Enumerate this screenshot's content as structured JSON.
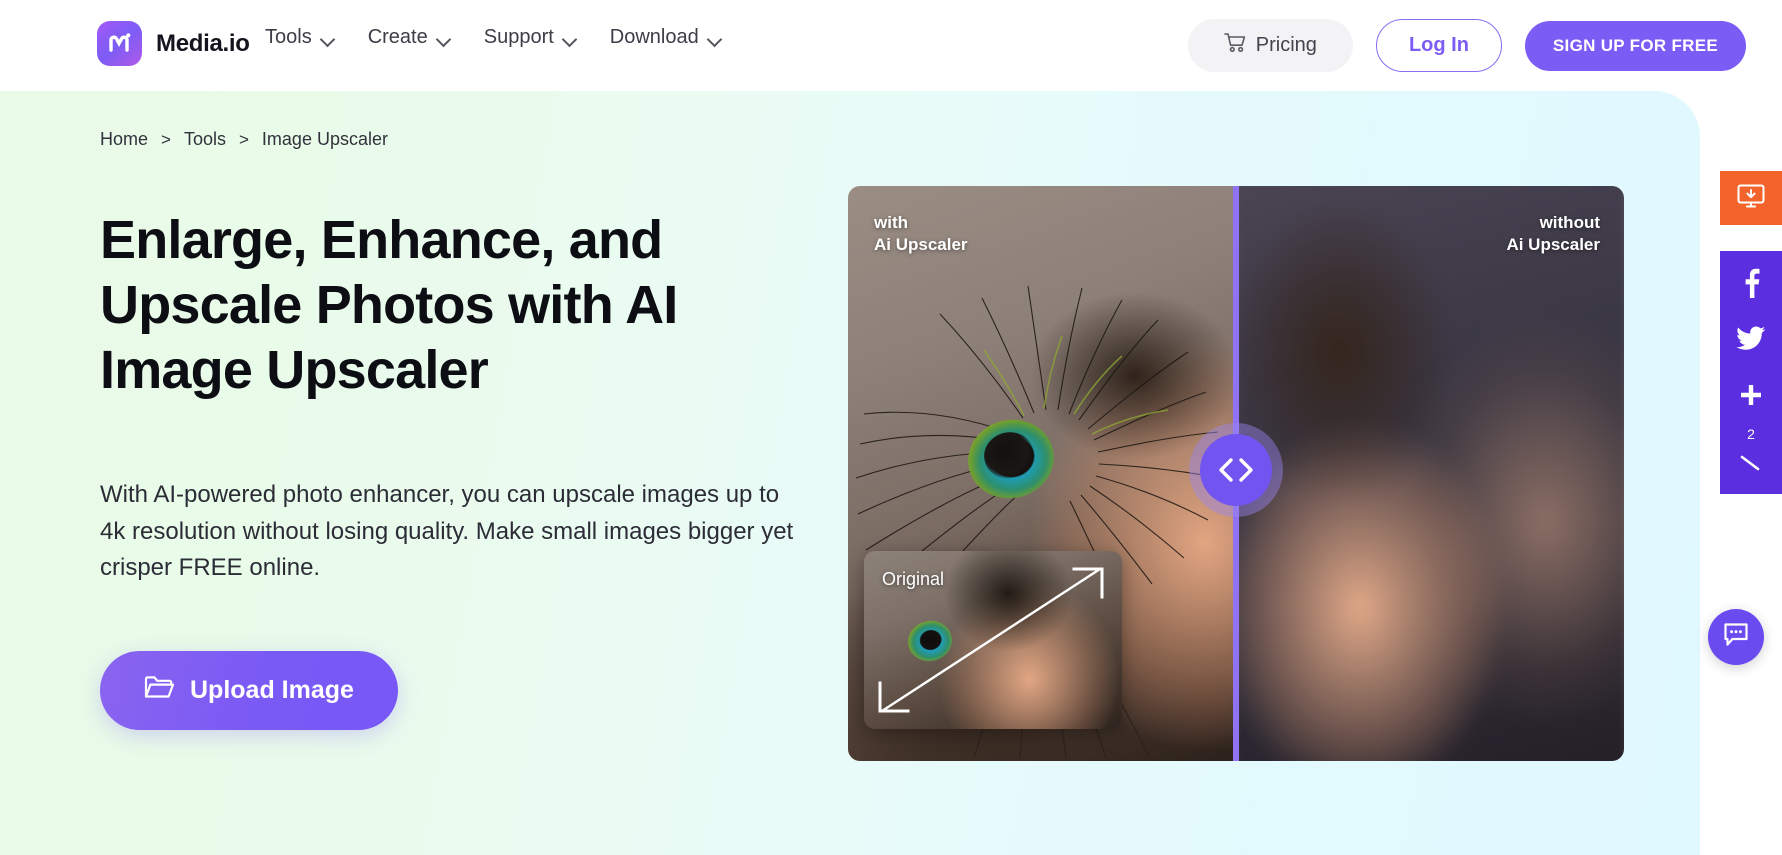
{
  "header": {
    "brand": "Media.io",
    "logo_icon": "media-io-logo-icon",
    "nav": [
      {
        "label": "Tools",
        "icon": "chevron-down-icon"
      },
      {
        "label": "Create",
        "icon": "chevron-down-icon"
      },
      {
        "label": "Support",
        "icon": "chevron-down-icon"
      },
      {
        "label": "Download",
        "icon": "chevron-down-icon"
      }
    ],
    "pricing_label": "Pricing",
    "pricing_icon": "shopping-cart-icon",
    "login_label": "Log In",
    "signup_label": "SIGN UP FOR FREE"
  },
  "breadcrumb": {
    "home": "Home",
    "sep1": ">",
    "tools": "Tools",
    "sep2": ">",
    "current": "Image Upscaler"
  },
  "hero": {
    "title": "Enlarge, Enhance, and Upscale Photos with AI Image Upscaler",
    "subtitle": "With AI-powered photo enhancer, you can upscale images up to 4k resolution without losing quality. Make small images bigger yet crisper FREE online.",
    "upload_label": "Upload Image",
    "upload_icon": "folder-icon"
  },
  "compare": {
    "left_label": "with\nAi Upscaler",
    "right_label": "without\nAi Upscaler",
    "original_label": "Original",
    "handle_icon": "left-right-chevrons-icon",
    "zoom_icon": "diagonal-expand-arrow-icon"
  },
  "rail": {
    "download_icon": "monitor-download-icon",
    "facebook_icon": "facebook-icon",
    "twitter_icon": "twitter-icon",
    "plus_icon": "plus-share-icon",
    "share_count": "2",
    "more_icon": "share-more-icon",
    "chat_icon": "chat-bubble-icon"
  },
  "colors": {
    "brand_purple": "#7b5cf5",
    "rail_orange": "#f2642b",
    "rail_purple": "#5b2ee0",
    "hero_gradient_start": "#e9fbe8",
    "hero_gradient_end": "#e0f8ff"
  }
}
